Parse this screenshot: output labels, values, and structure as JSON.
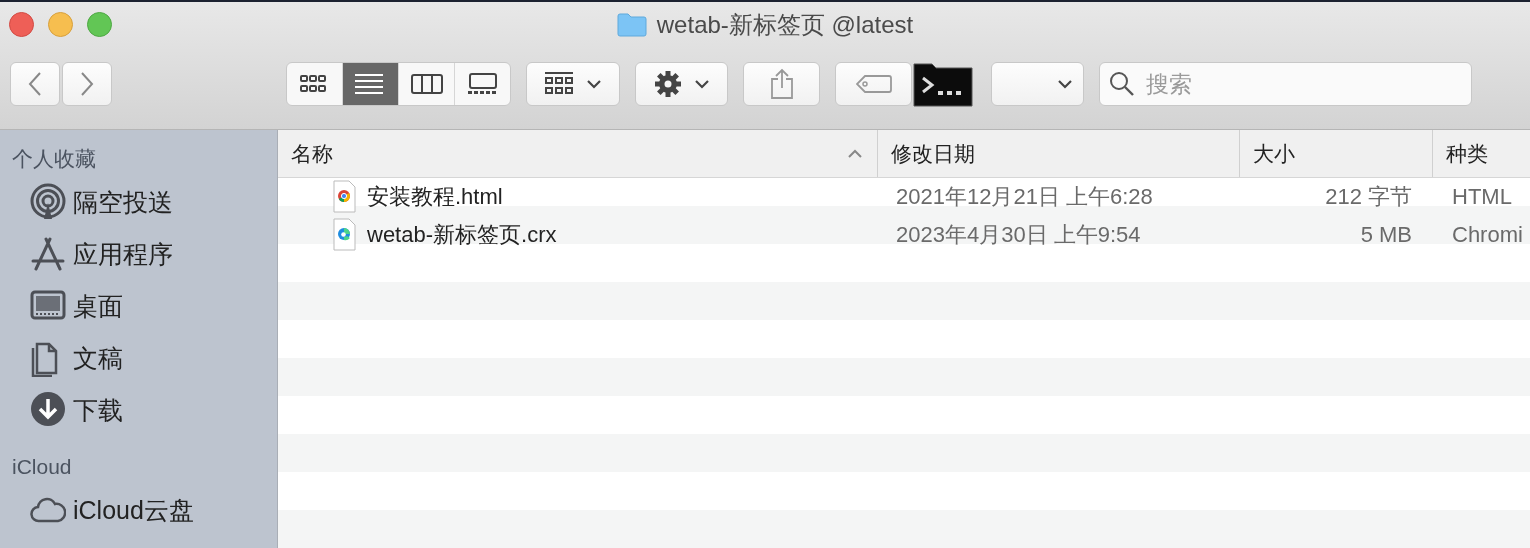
{
  "window": {
    "title": "wetab-新标签页 @latest"
  },
  "toolbar": {
    "view_modes": [
      {
        "kind": "icons",
        "selected": false
      },
      {
        "kind": "list",
        "selected": true
      },
      {
        "kind": "columns",
        "selected": false
      },
      {
        "kind": "gallery",
        "selected": false
      }
    ],
    "search": {
      "placeholder": "搜索"
    }
  },
  "sidebar": {
    "sections": [
      {
        "title": "个人收藏",
        "items": [
          {
            "kind": "airdrop",
            "label": "隔空投送"
          },
          {
            "kind": "apps",
            "label": "应用程序"
          },
          {
            "kind": "desktop",
            "label": "桌面"
          },
          {
            "kind": "documents",
            "label": "文稿"
          },
          {
            "kind": "downloads",
            "label": "下载"
          }
        ]
      },
      {
        "title": "iCloud",
        "items": [
          {
            "kind": "cloud",
            "label": "iCloud云盘"
          }
        ]
      }
    ]
  },
  "table": {
    "columns": [
      {
        "label": "名称",
        "sorted": true
      },
      {
        "label": "修改日期",
        "sorted": false
      },
      {
        "label": "大小",
        "sorted": false
      },
      {
        "label": "种类",
        "sorted": false
      }
    ],
    "rows": [
      {
        "kind": "chrome",
        "name": "安装教程.html",
        "modified": "2021年12月21日 上午6:28",
        "size": "212 字节",
        "type": "HTML"
      },
      {
        "kind": "edge",
        "name": "wetab-新标签页.crx",
        "modified": "2023年4月30日 上午9:54",
        "size": "5 MB",
        "type": "Chromi"
      }
    ]
  }
}
